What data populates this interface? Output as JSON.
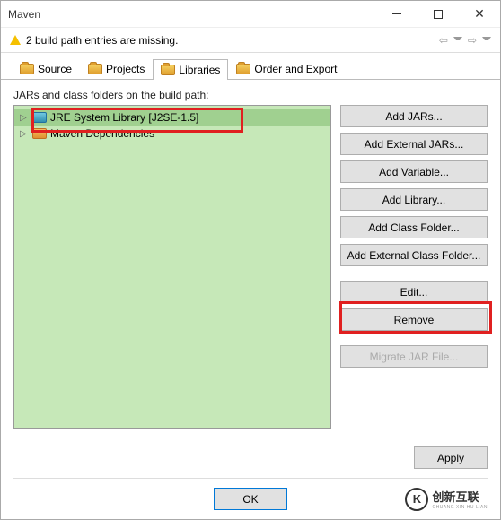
{
  "window": {
    "title": "Maven"
  },
  "warning": {
    "text": "2 build path entries are missing."
  },
  "tabs": {
    "source": "Source",
    "projects": "Projects",
    "libraries": "Libraries",
    "order": "Order and Export"
  },
  "content": {
    "label": "JARs and class folders on the build path:",
    "tree": {
      "item1": "JRE System Library [J2SE-1.5]",
      "item2": "Maven Dependencies"
    }
  },
  "buttons": {
    "addJars": "Add JARs...",
    "addExternalJars": "Add External JARs...",
    "addVariable": "Add Variable...",
    "addLibrary": "Add Library...",
    "addClassFolder": "Add Class Folder...",
    "addExternalClassFolder": "Add External Class Folder...",
    "edit": "Edit...",
    "remove": "Remove",
    "migrate": "Migrate JAR File...",
    "apply": "Apply",
    "ok": "OK"
  },
  "logo": {
    "main": "创新互联",
    "sub": "CHUANG XIN HU LIAN",
    "mark": "K"
  }
}
